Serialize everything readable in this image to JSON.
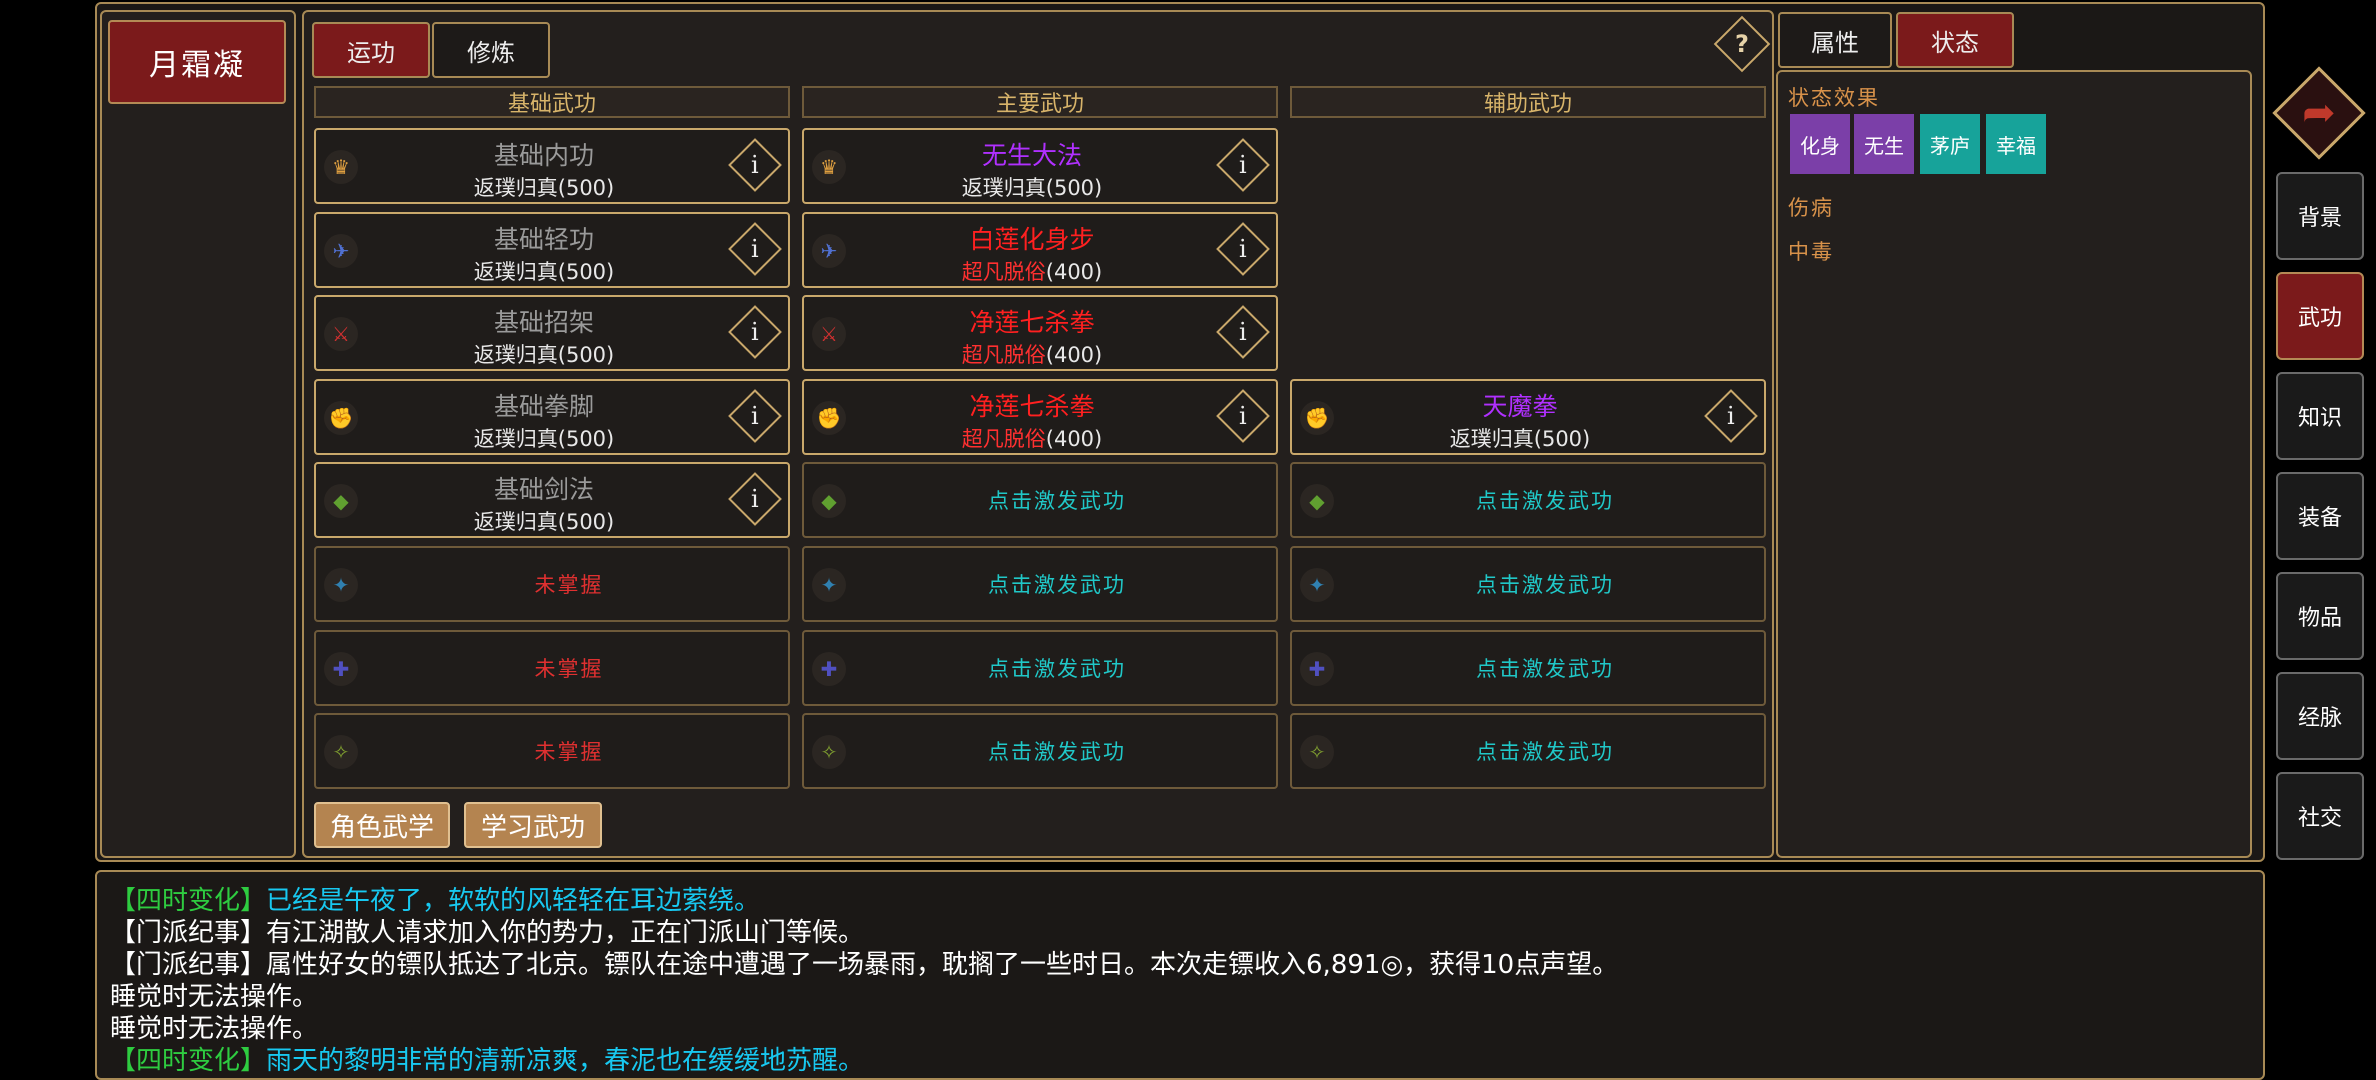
{
  "character": {
    "name": "月霜凝"
  },
  "center_tabs": [
    {
      "label": "运功",
      "active": true
    },
    {
      "label": "修炼",
      "active": false
    }
  ],
  "help_icon": "?",
  "columns": {
    "basic": {
      "header": "基础武功"
    },
    "main": {
      "header": "主要武功"
    },
    "aux": {
      "header": "辅助武功"
    }
  },
  "slot_icons": [
    "neigong-icon",
    "qinggong-icon",
    "zhaojia-icon",
    "quanjiao-icon",
    "jianfa-icon",
    "daofa-icon",
    "changbing-icon",
    "qimen-icon"
  ],
  "basic_slots": [
    {
      "name": "基础内功",
      "level": "返璞归真(500)"
    },
    {
      "name": "基础轻功",
      "level": "返璞归真(500)"
    },
    {
      "name": "基础招架",
      "level": "返璞归真(500)"
    },
    {
      "name": "基础拳脚",
      "level": "返璞归真(500)"
    },
    {
      "name": "基础剑法",
      "level": "返璞归真(500)"
    },
    {
      "text": "未掌握"
    },
    {
      "text": "未掌握"
    },
    {
      "text": "未掌握"
    }
  ],
  "main_slots": [
    {
      "name": "无生大法",
      "level": "返璞归真(500)"
    },
    {
      "name": "白莲化身步",
      "level_rank": "超凡脱俗",
      "level_value": "(400)"
    },
    {
      "name": "净莲七杀拳",
      "level_rank": "超凡脱俗",
      "level_value": "(400)"
    },
    {
      "name": "净莲七杀拳",
      "level_rank": "超凡脱俗",
      "level_value": "(400)"
    },
    {
      "text": "点击激发武功"
    },
    {
      "text": "点击激发武功"
    },
    {
      "text": "点击激发武功"
    },
    {
      "text": "点击激发武功"
    }
  ],
  "aux_slots": [
    {
      "name": "天魔拳",
      "level": "返璞归真(500)"
    },
    {
      "text": "点击激发武功"
    },
    {
      "text": "点击激发武功"
    },
    {
      "text": "点击激发武功"
    },
    {
      "text": "点击激发武功"
    }
  ],
  "bottom_buttons": {
    "role_martial": "角色武学",
    "learn_martial": "学习武功"
  },
  "right_tabs": [
    {
      "label": "属性",
      "active": false
    },
    {
      "label": "状态",
      "active": true
    }
  ],
  "status": {
    "effects_title": "状态效果",
    "effects": [
      {
        "label": "化身",
        "color": "#7b3fa8"
      },
      {
        "label": "无生",
        "color": "#7b3fa8"
      },
      {
        "label": "茅庐",
        "color": "#17a39a"
      },
      {
        "label": "幸福",
        "color": "#17a39a"
      }
    ],
    "injury_title": "伤病",
    "poison_title": "中毒"
  },
  "side_menu": [
    {
      "label": "背景",
      "active": false
    },
    {
      "label": "武功",
      "active": true
    },
    {
      "label": "知识",
      "active": false
    },
    {
      "label": "装备",
      "active": false
    },
    {
      "label": "物品",
      "active": false
    },
    {
      "label": "经脉",
      "active": false
    },
    {
      "label": "社交",
      "active": false
    }
  ],
  "log": [
    {
      "tag": "【四时变化】",
      "text": "已经是午夜了，软软的风轻轻在耳边萦绕。",
      "tag_color": "green",
      "text_color": "cyan"
    },
    {
      "tag": "【门派纪事】",
      "text": "有江湖散人请求加入你的势力，正在门派山门等候。",
      "tag_color": "white",
      "text_color": "white"
    },
    {
      "tag": "【门派纪事】",
      "text": "属性好女的镖队抵达了北京。镖队在途中遭遇了一场暴雨，耽搁了一些时日。本次走镖收入6,891◎，获得10点声望。",
      "tag_color": "white",
      "text_color": "white"
    },
    {
      "tag": "",
      "text": "睡觉时无法操作。",
      "tag_color": "white",
      "text_color": "white"
    },
    {
      "tag": "",
      "text": "睡觉时无法操作。",
      "tag_color": "white",
      "text_color": "white"
    },
    {
      "tag": "【四时变化】",
      "text": "雨天的黎明非常的清新凉爽，春泥也在缓缓地苏醒。",
      "tag_color": "green",
      "text_color": "cyan"
    }
  ],
  "colors": {
    "grey_name": "#9a9a9a",
    "purple_name": "#b030ff",
    "red_name": "#ff2020",
    "red_rank": "#ff3030",
    "not_learned": "#e03030",
    "activate": "#20c8c8"
  }
}
